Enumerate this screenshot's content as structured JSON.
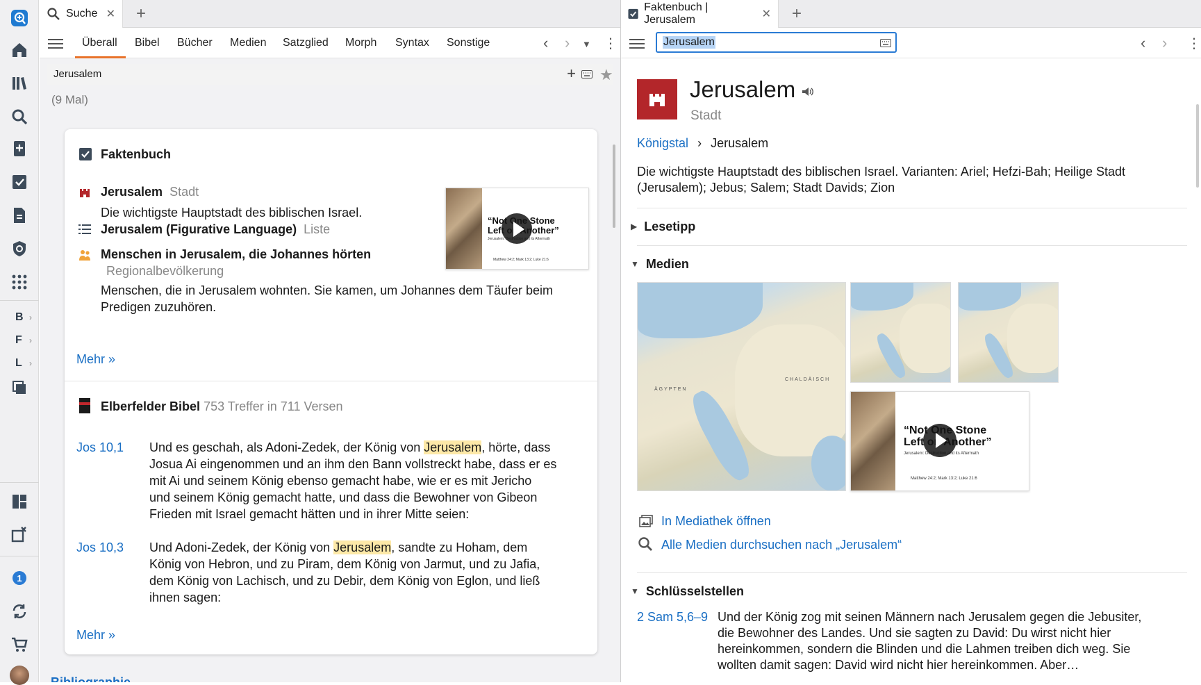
{
  "rail": {
    "letters": [
      "B",
      "F",
      "L"
    ],
    "badge": "1"
  },
  "left": {
    "tab": {
      "label": "Suche"
    },
    "tabs": [
      "Überall",
      "Bibel",
      "Bücher",
      "Medien",
      "Satzglied",
      "Morph",
      "Syntax",
      "Sonstige"
    ],
    "query": "Jerusalem",
    "count": "(9 Mal)",
    "fact": {
      "heading": "Faktenbuch",
      "items": [
        {
          "title": "Jerusalem",
          "kind": "Stadt",
          "desc": "Die wichtigste Hauptstadt des biblischen Israel."
        },
        {
          "title": "Jerusalem (Figurative Language)",
          "kind": "Liste"
        },
        {
          "title": "Menschen in Jerusalem, die Johannes hörten",
          "kind": "Regionalbevölkerung",
          "desc1": "Menschen, die in Jerusalem wohnten. Sie kamen, um Johannes dem Täufer beim",
          "desc2": "Predigen zuzuhören."
        }
      ],
      "more": "Mehr »",
      "video": {
        "title1": "“Not One Stone",
        "title2": "Left on Another”",
        "sub": "Jerusalem: Destruction and its Aftermath",
        "refs": "Matthew 24:2; Mark 13:2; Luke 21:6"
      }
    },
    "bible": {
      "heading": "Elberfelder Bibel",
      "hits": "753 Treffer in 711 Versen",
      "verses": [
        {
          "ref": "Jos 10,1",
          "l1a": "Und es geschah, als Adoni-Zedek, der König von ",
          "hl": "Jerusalem",
          "l1b": ", hörte, dass",
          "l2": "Josua Ai eingenommen und an ihm den Bann vollstreckt habe, dass er es",
          "l3": "mit Ai und seinem König ebenso gemacht habe, wie er es mit Jericho",
          "l4": "und seinem König gemacht hatte, und dass die Bewohner von Gibeon",
          "l5": "Frieden mit Israel gemacht hätten und in ihrer Mitte seien:"
        },
        {
          "ref": "Jos 10,3",
          "l1a": "Und Adoni-Zedek, der König von ",
          "hl": "Jerusalem",
          "l1b": ", sandte zu Hoham, dem",
          "l2": "König von Hebron, und zu Piram, dem König von Jarmut, und zu Jafia,",
          "l3": "dem König von Lachisch, und zu Debir, dem König von Eglon, und ließ",
          "l4": "ihnen sagen:"
        }
      ],
      "more": "Mehr »"
    },
    "bottom_cut": "Bibliographie"
  },
  "right": {
    "tab": {
      "label": "Faktenbuch | Jerusalem"
    },
    "search": "Jerusalem",
    "title": "Jerusalem",
    "kind": "Stadt",
    "crumb_parent": "Königstal",
    "crumb_sep": "›",
    "crumb_current": "Jerusalem",
    "desc1": "Die wichtigste Hauptstadt des biblischen Israel. Varianten: Ariel; Hefzi-Bah; Heilige Stadt",
    "desc2": "(Jerusalem); Jebus; Salem; Stadt Davids; Zion",
    "sec_lesetipp": "Lesetipp",
    "sec_medien": "Medien",
    "map_labels": {
      "egypt": "ÄGYPTEN",
      "chald": "CHALDÄISCH"
    },
    "link_mediathek": "In Mediathek öffnen",
    "link_search": "Alle Medien durchsuchen nach „Jerusalem“",
    "sec_schluessel": "Schlüsselstellen",
    "key": {
      "ref": "2 Sam 5,6–9",
      "l1": "Und der König zog mit seinen Männern nach Jerusalem gegen die Jebusiter,",
      "l2": "die Bewohner des Landes. Und sie sagten zu David: Du wirst nicht hier",
      "l3": "hereinkommen, sondern die Blinden und die Lahmen treiben dich weg. Sie",
      "l4": "wollten damit sagen: David wird nicht hier hereinkommen. Aber…"
    }
  },
  "colors": {
    "accent": "#e8732b",
    "link": "#1a6fc4",
    "city_badge": "#b3262a",
    "highlight": "#fde9a8"
  }
}
